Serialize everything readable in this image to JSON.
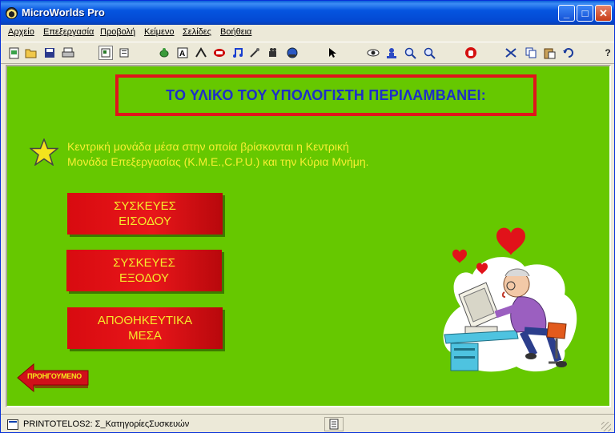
{
  "window": {
    "title": "MicroWorlds Pro",
    "controls": {
      "minimize": "_",
      "maximize": "□",
      "close": "✕"
    }
  },
  "menu": [
    {
      "label": "Αρχείο"
    },
    {
      "label": "Επεξεργασία"
    },
    {
      "label": "Προβολή"
    },
    {
      "label": "Κείμενο"
    },
    {
      "label": "Σελίδες"
    },
    {
      "label": "Βοήθεια"
    }
  ],
  "toolbar": {
    "icons": [
      "new-page-icon",
      "open-icon",
      "save-icon",
      "print-icon",
      "page-view-icon",
      "procedures-view-icon",
      "new-turtle-icon",
      "text-box-icon",
      "button-icon",
      "slider-icon",
      "music-icon",
      "sound-icon",
      "video-icon",
      "record-icon",
      "pointer-icon",
      "eye-icon",
      "stamp-icon",
      "zoom-in-icon",
      "zoom-out-icon",
      "stop-icon",
      "cut-icon",
      "copy-icon",
      "paste-icon",
      "undo-icon",
      "help-icon"
    ]
  },
  "page": {
    "heading": "ΤΟ ΥΛΙΚΟ ΤΟΥ ΥΠΟΛΟΓΙΣΤΗ ΠΕΡΙΛΑΜΒΑΝΕΙ:",
    "description_line1": "Κεντρική μονάδα μέσα στην οποία βρίσκονται η Κεντρική",
    "description_line2": "Μονάδα Επεξεργασίας (Κ.Μ.Ε.,C.P.U.) και την Κύρια Μνήμη.",
    "buttons": [
      {
        "line1": "ΣΥΣΚΕΥΕΣ",
        "line2": "ΕΙΣΟΔΟΥ"
      },
      {
        "line1": "ΣΥΣΚΕΥΕΣ",
        "line2": "ΕΞΟΔΟΥ"
      },
      {
        "line1": "ΑΠΟΘΗΚΕΥΤΙΚΑ",
        "line2": "ΜΕΣΑ"
      }
    ],
    "prev_label": "ΠΡΟΗΓΟΥΜΕΝΟ"
  },
  "status": {
    "text": "PRINTOTELOS2:  Σ_ΚατηγορίεςΣυσκευών"
  },
  "colors": {
    "canvas_bg": "#66c800",
    "heading": "#1e2fc9",
    "heading_border": "#e0151b",
    "description": "#f7ef32",
    "button_bg": "#e8161a",
    "button_text": "#f6ea2c"
  }
}
